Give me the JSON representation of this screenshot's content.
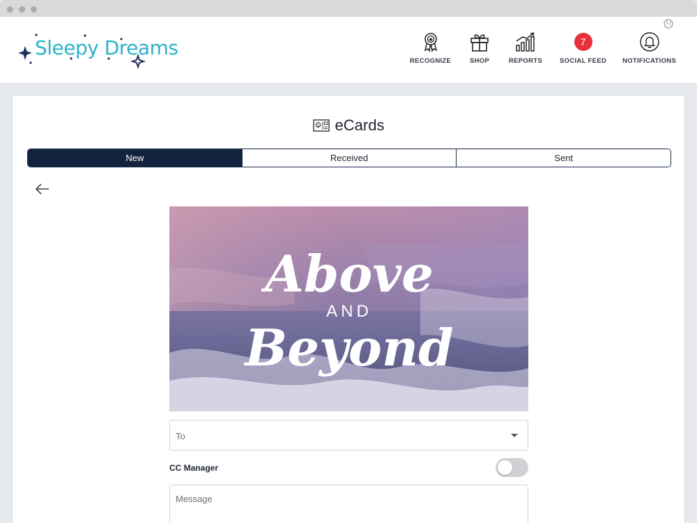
{
  "app": {
    "brand_name": "Sleepy Dreams",
    "brand_color": "#2bb3c9",
    "accent_dark": "#13233d"
  },
  "nav": {
    "recognize": {
      "label": "RECOGNIZE",
      "icon": "award-ribbon-icon"
    },
    "shop": {
      "label": "SHOP",
      "icon": "gift-icon"
    },
    "reports": {
      "label": "REPORTS",
      "icon": "bar-chart-icon"
    },
    "social_feed": {
      "label": "SOCIAL FEED",
      "badge_count": "7",
      "badge_color": "#e8313b"
    },
    "notifications": {
      "label": "NOTIFICATIONS",
      "icon": "bell-icon"
    }
  },
  "page": {
    "title": "eCards",
    "title_icon": "ecard-icon",
    "tabs": [
      {
        "label": "New",
        "active": true
      },
      {
        "label": "Received",
        "active": false
      },
      {
        "label": "Sent",
        "active": false
      }
    ]
  },
  "ecard": {
    "line1": "Above",
    "line2": "AND",
    "line3": "Beyond"
  },
  "form": {
    "to_placeholder": "To",
    "cc_manager_label": "CC Manager",
    "cc_manager_on": false,
    "message_placeholder": "Message"
  }
}
